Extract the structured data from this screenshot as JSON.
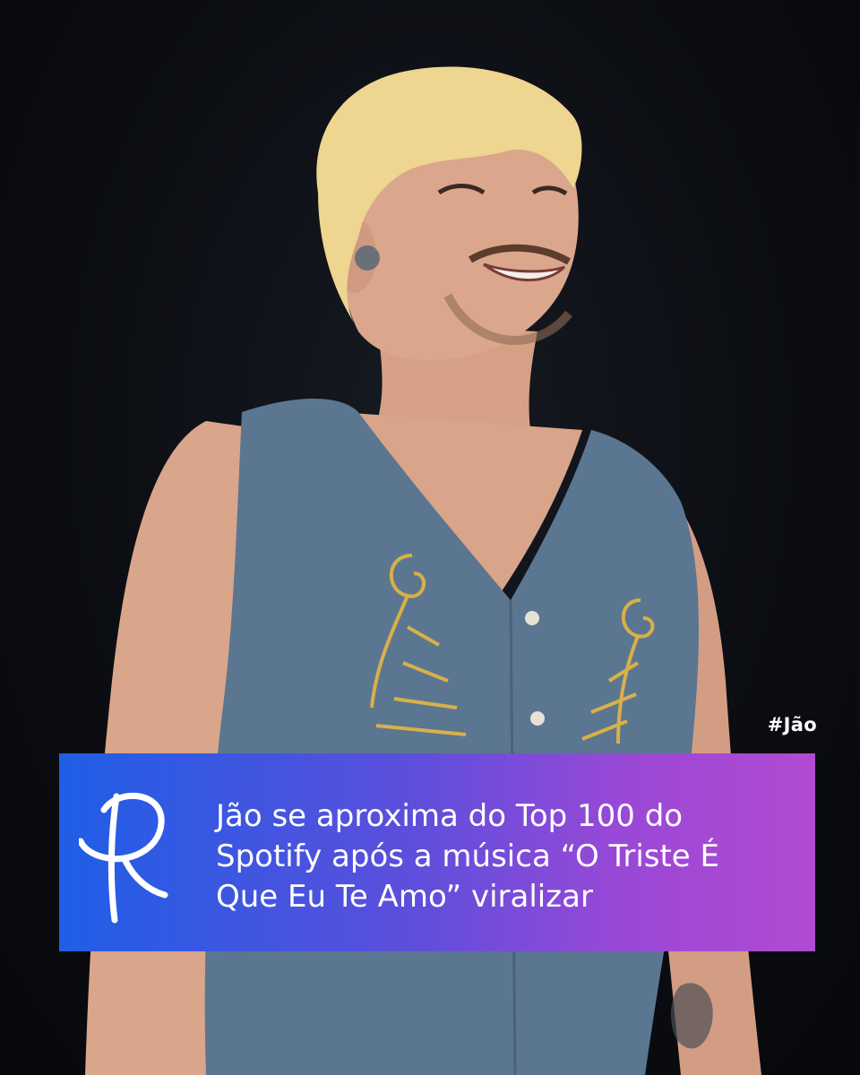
{
  "post": {
    "hashtag": "#Jão",
    "headline_lines": [
      "Jão se aproxima do Top 100 do",
      "Spotify após a música “O Triste É",
      "Que Eu Te Amo” viralizar"
    ],
    "logo_icon": "r-script-logo-icon",
    "banner_colors": [
      "#1f5ee6",
      "#5a4fdc",
      "#9a48d6",
      "#b24ad2"
    ],
    "background_color": "#0b0d12"
  }
}
